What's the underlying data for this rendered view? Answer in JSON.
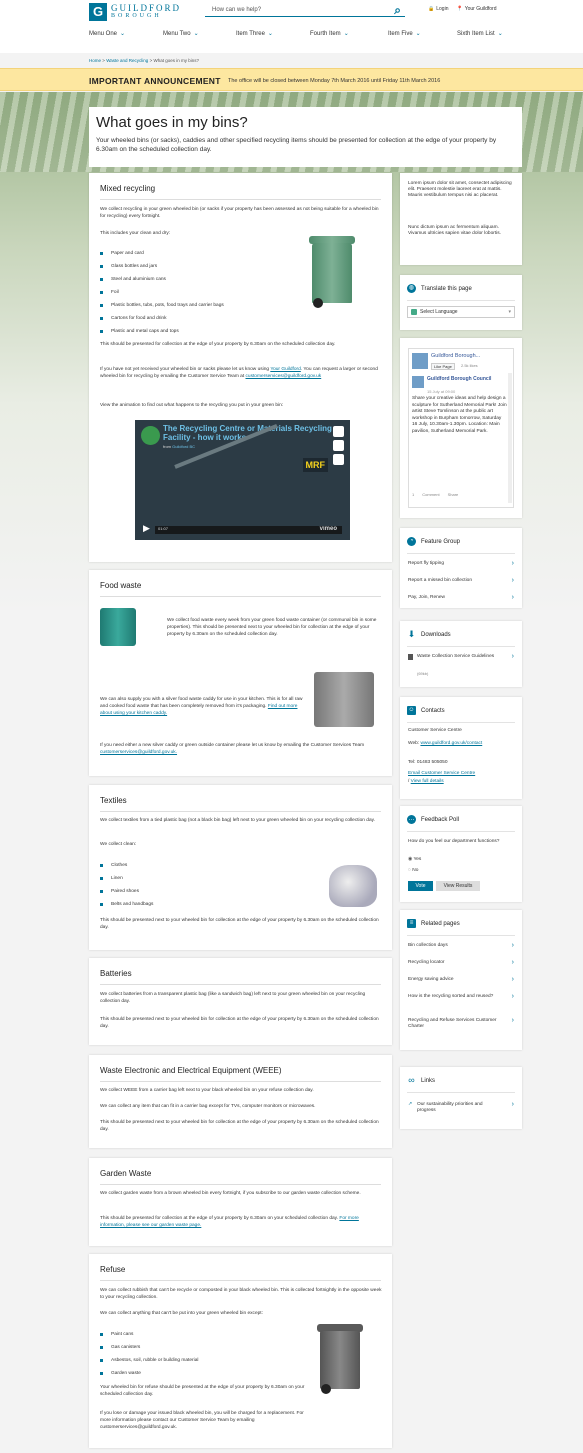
{
  "header": {
    "logo_letter": "G",
    "logo_line1": "GUILDFORD",
    "logo_line2": "BOROUGH",
    "search_placeholder": "How can we help?",
    "login": "Login",
    "your_guildford": "Your Guildford",
    "nav": [
      "Menu One",
      "Menu Two",
      "Item Three",
      "Fourth Item",
      "Item Five",
      "Sixth Item List"
    ]
  },
  "breadcrumb": [
    "Home",
    ">",
    "Waste and Recycling",
    ">",
    "What goes in my bins?"
  ],
  "announcement": {
    "label": "IMPORTANT ANNOUNCEMENT",
    "text": "The office will be closed between Monday 7th March 2016 until Friday 11th March 2016"
  },
  "page": {
    "title": "What goes in my bins?",
    "intro": "Your wheeled bins (or sacks), caddies and other specified recycling items should be presented for collection at the edge of your property by 6.30am on the scheduled collection day."
  },
  "mixed": {
    "heading": "Mixed recycling",
    "p1": "We collect recycling in your green wheeled bin (or sacks if your property has been assessed as not being suitable for a wheeled bin for recycling) every fortnight.",
    "p2": "This includes your clean and dry:",
    "items": [
      "Paper and card",
      "Glass bottles and jars",
      "Steel and aluminium cans",
      "Foil",
      "Plastic bottles, tubs, pots, food trays and carrier bags",
      "Cartons for food and drink",
      "Plastic and metal caps and tops"
    ],
    "p3": "This should be presented for collection at the edge of your property by 6.30am on the scheduled collection day.",
    "p4a": "If you have not yet received your wheeled bin or sacks please let us know using ",
    "p4link": "Your Guildford",
    "p4b": ". You can request a larger or second wheeled bin for recycling by emailing the Customer Service Team at ",
    "p4email": "customerservices@guildford.gov.uk",
    "p5": "View the animation to find out what happens to the recycling you put in your green bin:",
    "video_title": "The Recycling Centre or Materials Recycling Facility - how it works",
    "video_from": "from",
    "video_author": "Guildford BC",
    "video_brand": "vimeo",
    "video_label": "MRF",
    "video_time": "01:07"
  },
  "food": {
    "heading": "Food waste",
    "p1": "We collect food waste every week from your green food waste container (or communal bin in some properties). This should be presented next to your wheeled bin for collection at the edge of your property by 6.30am on the scheduled collection day.",
    "p2": "We can also supply you with a silver food waste caddy for use in your kitchen. This is for all raw and cooked food waste that has been completely removed from it's packaging.",
    "p2link": "Find out more about using your kitchen caddy.",
    "p3": "If you need either a new silver caddy or green outside container please let us know by emailing the Customer Services Team",
    "p3email": "customerservices@guildford.gov.uk."
  },
  "textiles": {
    "heading": "Textiles",
    "p1": "We collect textiles from a tied plastic bag (not a black bin bag) left next to your green wheeled bin on your recycling collection day.",
    "p2": "We collect clean:",
    "items": [
      "Clothes",
      "Linen",
      "Paired shoes",
      "Belts and handbags"
    ],
    "p3": "This should be presented next to your wheeled bin for collection at the edge of your property by 6.30am on the scheduled collection day."
  },
  "batteries": {
    "heading": "Batteries",
    "p1": "We collect batteries from a transparent plastic bag (like a sandwich bag) left next to your green wheeled bin on your recycling collection day.",
    "p2": "This should be presented next to your wheeled bin for collection at the edge of your property by 6.30am on the scheduled collection day."
  },
  "weee": {
    "heading": "Waste Electronic and Electrical Equipment (WEEE)",
    "p1": "We collect WEEE from a carrier bag left next to your black wheeled bin on your refuse collection day.",
    "p2": "We can collect any item that can fit in a carrier bag except for TVs, computer monitors or microwaves.",
    "p3": "This should be presented next to your wheeled bin for collection at the edge of your property by 6.30am on the scheduled collection day."
  },
  "garden": {
    "heading": "Garden Waste",
    "p1": "We collect garden waste from a brown wheeled bin every fortnight, if you subscribe to our garden waste collection scheme.",
    "p2": "This should be presented for collection at the edge of your property by 6.30am on your scheduled collection day.",
    "p2link": "For more information, please see our garden waste page."
  },
  "refuse": {
    "heading": "Refuse",
    "p1": "We can collect rubbish that can't be recycle or composted in your black wheeled bin. This is collected fortnightly in the opposite week to your recycling collection.",
    "p2": "We can collect anything that can't be put into your green wheeled bin except:",
    "items": [
      "Paint cans",
      "Gas canisters",
      "Asbestos, soil, rubble or building material",
      "Garden waste"
    ],
    "p3": "Your wheeled bin for refuse should be presented at the edge of your property by 6.30am on your scheduled collection day.",
    "p4": "If you lose or damage your issued black wheeled bin, you will be charged for a replacement. For more information please contact our Customer Service Team by emailing",
    "p4email": "customerservices@guildford.gov.uk."
  },
  "sidebar": {
    "lorem1": "Lorem ipsum dolor sit amet, consectet adipiscing elit. Praesent molestie laoreet erat at mattis. Mauris vestibulum tempus nisi ac placerat.",
    "lorem2": "Nunc dictum ipsum ac fermentum aliquam. Vivamus ultricies sapien vitae dolor lobortis.",
    "translate_heading": "Translate this page",
    "select_language": "Select Language",
    "fb": {
      "page_name": "Guildford Borough...",
      "like_page": "Like Page",
      "likes": "2.5k likes",
      "post_author": "Guildford Borough Council",
      "post_date": "15 July at 09:00",
      "post_text": "Share your creative ideas and help design a sculpture for Sutherland Memorial Park! Join artist Steve Tomlinson at the public art workshop in Burpham tomorrow, Saturday 16 July, 10.30am-1.30pm. Location: Main pavilion, Sutherland Memorial Park.",
      "post_likes": "1",
      "comment": "Comment",
      "share": "Share"
    },
    "feature": {
      "heading": "Feature Group",
      "links": [
        "Report fly tipping",
        "Report a missed bin collection",
        "Pay, Join, Renew"
      ]
    },
    "downloads": {
      "heading": "Downloads",
      "file": "Waste Collection Service Guidelines",
      "meta": "(69kb)"
    },
    "contacts": {
      "heading": "Contacts",
      "name": "Customer Service Centre",
      "web_label": "Web:",
      "web": "www.guildford.gov.uk/contact",
      "tel_label": "Tel:",
      "tel": "01483 505050",
      "email_link": "Email Customer Service Centre",
      "details_link": "View full details"
    },
    "poll": {
      "heading": "Feedback Poll",
      "question": "How do you feel our department functions?",
      "options": [
        "Yes",
        "No"
      ],
      "vote": "Vote",
      "results": "View Results"
    },
    "related": {
      "heading": "Related pages",
      "links": [
        "Bin collection days",
        "Recycling locator",
        "Energy saving advice",
        "How is the recycling sorted and reused?",
        "Recycling and Refuse Services Customer Charter"
      ]
    },
    "links": {
      "heading": "Links",
      "items": [
        "Our sustainability priorities and progress"
      ]
    }
  },
  "colors": {
    "accent": "#00759a",
    "announcement_bg": "#fde7a0",
    "bin_green": "#5c9a78"
  }
}
